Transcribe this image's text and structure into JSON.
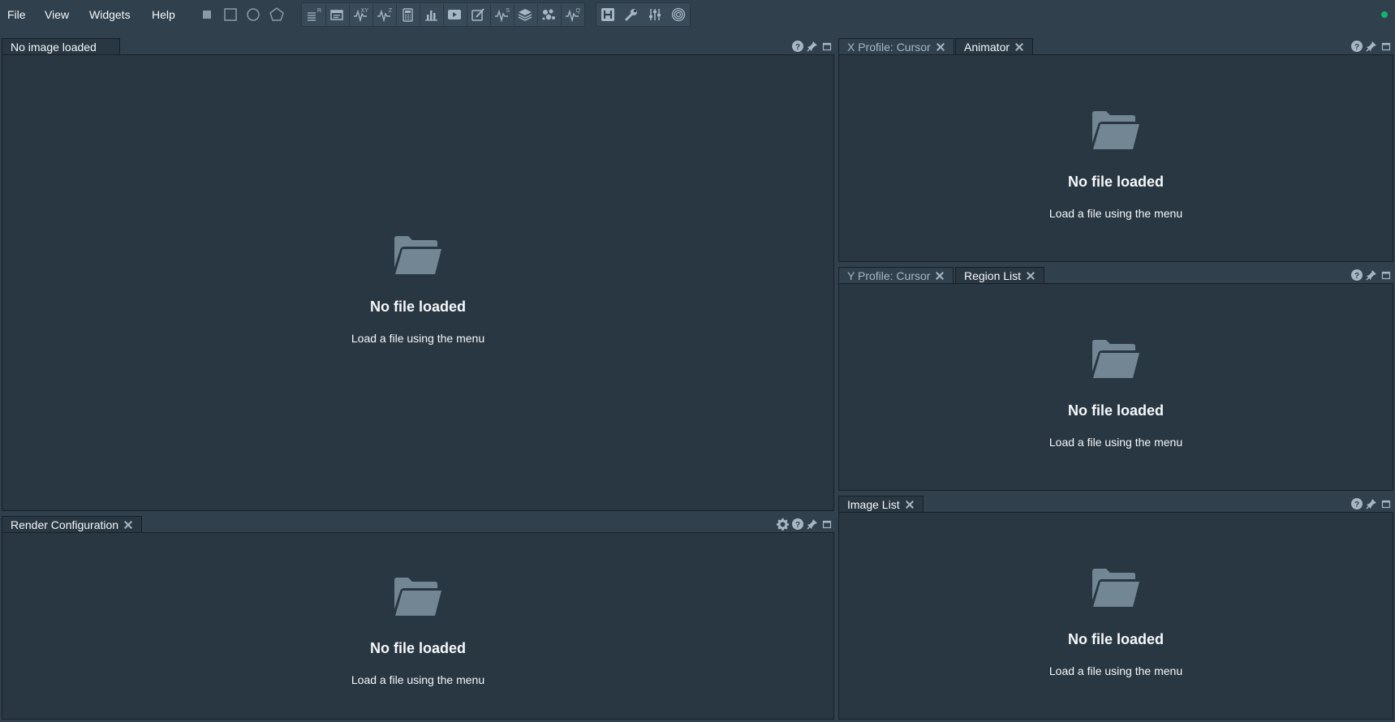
{
  "menu": {
    "file": "File",
    "view": "View",
    "widgets": "Widgets",
    "help": "Help"
  },
  "toolbar": {
    "region_tools": [
      "square-point-icon",
      "rectangle-region-icon",
      "ellipse-region-icon",
      "polygon-region-icon"
    ],
    "widget_buttons": [
      {
        "name": "region-list-icon",
        "sup": "R"
      },
      {
        "name": "image-list-icon",
        "sup": ""
      },
      {
        "name": "xy-profile-icon",
        "sup": "XY"
      },
      {
        "name": "z-profile-icon",
        "sup": "Z"
      },
      {
        "name": "calculator-icon",
        "sup": ""
      },
      {
        "name": "histogram-icon",
        "sup": ""
      },
      {
        "name": "animator-icon",
        "sup": ""
      },
      {
        "name": "log-icon",
        "sup": ""
      },
      {
        "name": "spectral-profiler-icon",
        "sup": "S"
      },
      {
        "name": "layers-icon",
        "sup": ""
      },
      {
        "name": "catalog-icon",
        "sup": ""
      },
      {
        "name": "stokes-icon",
        "sup": "Q"
      }
    ],
    "tool_buttons": [
      "header-icon",
      "wrench-icon",
      "sliders-icon",
      "rings-icon"
    ]
  },
  "status": {
    "color": "#15b371"
  },
  "panels": {
    "image": {
      "tab": "No image loaded",
      "empty_title": "No file loaded",
      "empty_sub": "Load a file using the menu"
    },
    "render": {
      "tab": "Render Configuration",
      "empty_title": "No file loaded",
      "empty_sub": "Load a file using the menu"
    },
    "top_right": {
      "tabs": [
        "X Profile: Cursor",
        "Animator"
      ],
      "empty_title": "No file loaded",
      "empty_sub": "Load a file using the menu"
    },
    "mid_right": {
      "tabs": [
        "Y Profile: Cursor",
        "Region List"
      ],
      "empty_title": "No file loaded",
      "empty_sub": "Load a file using the menu"
    },
    "bottom_right": {
      "tab": "Image List",
      "empty_title": "No file loaded",
      "empty_sub": "Load a file using the menu"
    }
  },
  "colors": {
    "background": "#30404d",
    "panel": "#293742",
    "folder": "#738694"
  }
}
